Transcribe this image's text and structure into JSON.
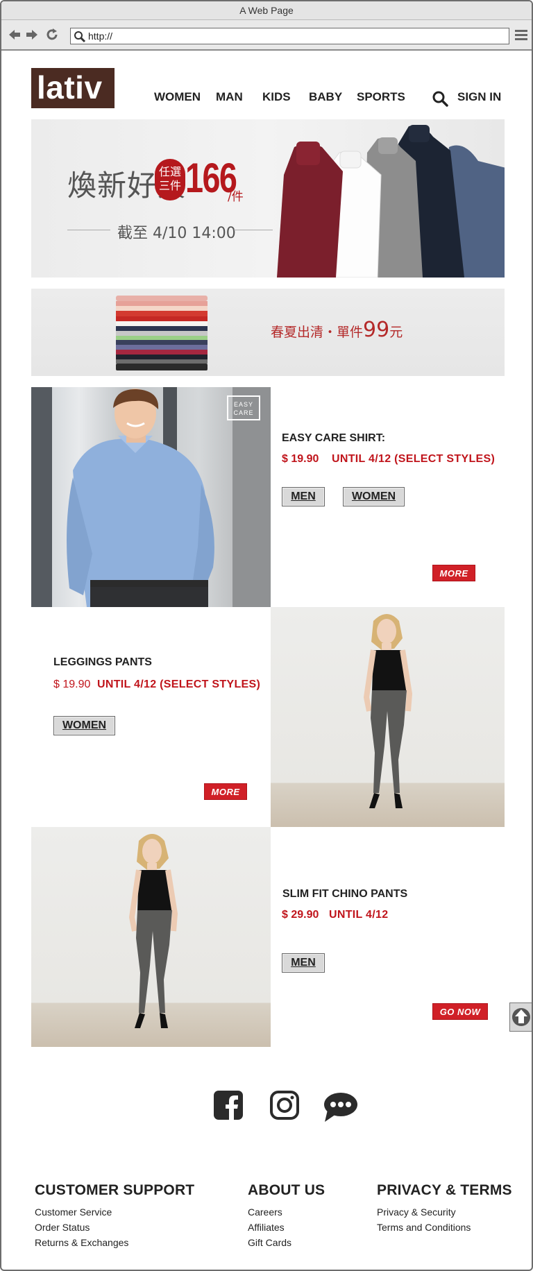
{
  "window": {
    "title": "A Web Page"
  },
  "browser": {
    "url": "http://"
  },
  "header": {
    "logo": "lativ",
    "nav": [
      "WOMEN",
      "MAN",
      "KIDS",
      "BABY",
      "SPORTS"
    ],
    "sign_in": "SIGN IN"
  },
  "banner1": {
    "headline": "煥新好貨",
    "badge_top": "任選",
    "badge_bottom": "三件",
    "price": "166",
    "unit": "/件",
    "deadline": "截至 4/10 14:00"
  },
  "banner2": {
    "text": "春夏出清・單件",
    "price": "99",
    "unit": "元"
  },
  "products": [
    {
      "title": "EASY CARE SHIRT:",
      "price": "$ 19.90",
      "promo": "UNTIL 4/12 (SELECT STYLES)",
      "buttons": [
        "MEN",
        "WOMEN"
      ],
      "cta": "MORE",
      "photo_tag_top": "EASY",
      "photo_tag_bottom": "CARE"
    },
    {
      "title": "LEGGINGS PANTS",
      "price": "$ 19.90",
      "promo": "UNTIL 4/12 (SELECT STYLES)",
      "buttons": [
        "WOMEN"
      ],
      "cta": "MORE"
    },
    {
      "title": "SLIM FIT CHINO PANTS",
      "price": "$ 29.90",
      "promo": "UNTIL 4/12",
      "buttons": [
        "MEN"
      ],
      "cta": "GO NOW"
    }
  ],
  "social": [
    "facebook-icon",
    "instagram-icon",
    "chat-icon"
  ],
  "footer": {
    "support": {
      "title": "CUSTOMER SUPPORT",
      "links": [
        "Customer Service",
        "Order Status",
        "Returns & Exchanges"
      ]
    },
    "about": {
      "title": "ABOUT US",
      "links": [
        "Careers",
        "Affiliates",
        "Gift Cards"
      ]
    },
    "privacy": {
      "title": "PRIVACY & TERMS",
      "links": [
        "Privacy & Security",
        "Terms and Conditions"
      ]
    }
  }
}
